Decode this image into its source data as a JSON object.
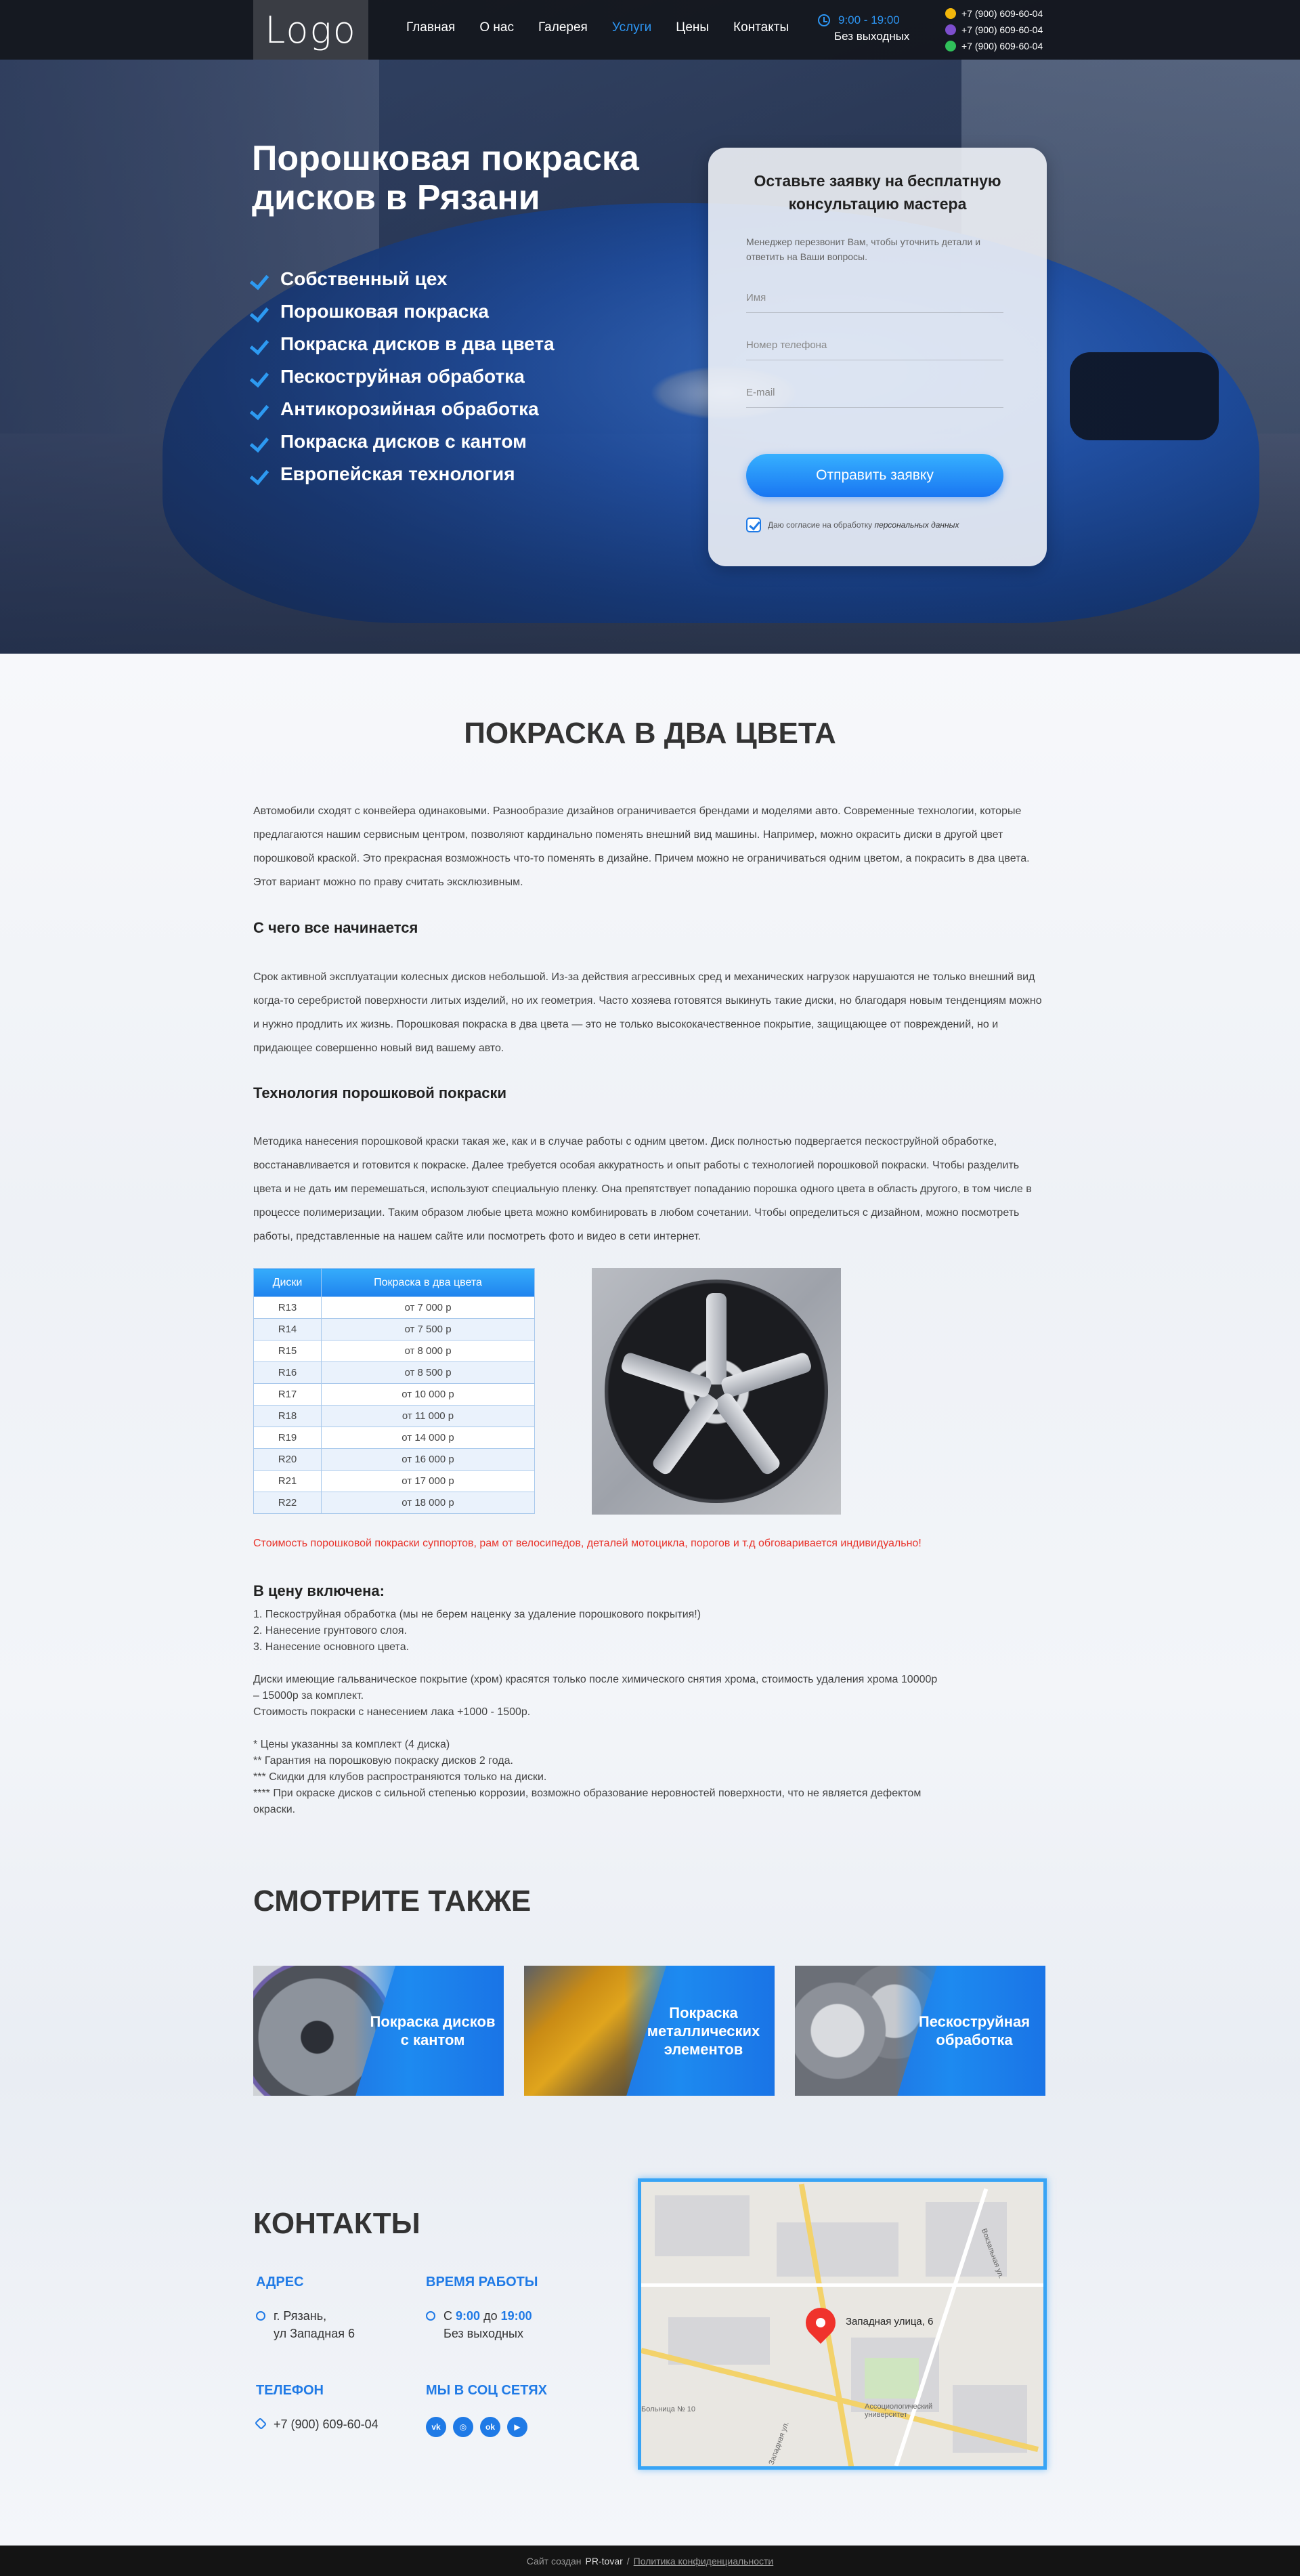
{
  "header": {
    "logo": "Logo",
    "nav": [
      "Главная",
      "О нас",
      "Галерея",
      "Услуги",
      "Цены",
      "Контакты"
    ],
    "active_nav": "Услуги",
    "hours_time": "9:00 - 19:00",
    "hours_days": "Без выходных",
    "phones": [
      "+7 (900) 609-60-04",
      "+7 (900) 609-60-04",
      "+7 (900) 609-60-04"
    ]
  },
  "hero": {
    "title": "Порошковая покраска дисков в Рязани",
    "features": [
      "Собственный цех",
      "Порошковая покраска",
      "Покраска дисков в два цвета",
      "Пескоструйная обработка",
      "Антикорозийная обработка",
      "Покраска дисков с кантом",
      "Европейская технология"
    ]
  },
  "form": {
    "title": "Оставьте заявку на бесплатную консультацию мастера",
    "note": "Менеджер перезвонит Вам, чтобы уточнить детали и ответить на Ваши вопросы.",
    "name_placeholder": "Имя",
    "phone_placeholder": "Номер телефона",
    "email_placeholder": "E-mail",
    "submit": "Отправить заявку",
    "consent_prefix": "Даю согласие на обработку",
    "consent_link": "персональных данных"
  },
  "article": {
    "title": "ПОКРАСКА В ДВА ЦВЕТА",
    "intro": "Автомобили сходят с конвейера одинаковыми. Разнообразие дизайнов ограничивается брендами и моделями авто. Современные технологии, которые предлагаются нашим сервисным центром, позволяют кардинально поменять внешний вид машины. Например, можно окрасить диски в другой цвет порошковой краской. Это прекрасная возможность что-то поменять в дизайне. Причем можно не ограничиваться одним цветом, а покрасить в два цвета. Этот вариант можно по праву считать эксклюзивным.",
    "sub1": "С чего все начинается",
    "para1": "Срок активной эксплуатации колесных дисков небольшой. Из-за действия агрессивных сред и механических нагрузок нарушаются не только внешний вид когда-то серебристой поверхности литых изделий, но их геометрия. Часто хозяева готовятся выкинуть такие диски, но благодаря новым тенденциям можно и нужно продлить их жизнь. Порошковая покраска в два цвета — это не только высококачественное покрытие, защищающее от повреждений, но и придающее совершенно новый вид вашему авто.",
    "sub2": "Технология порошковой покраски",
    "para2": "Методика нанесения порошковой краски такая же, как и в случае работы с одним цветом. Диск полностью подвергается пескоструйной обработке, восстанавливается и готовится к покраске. Далее требуется особая аккуратность и опыт работы с технологией порошковой покраски. Чтобы разделить цвета и не дать им перемешаться, используют специальную пленку. Она препятствует попаданию порошка одного цвета в область другого, в том числе в процессе полимеризации. Таким образом любые цвета можно комбинировать в любом сочетании. Чтобы определиться с дизайном, можно посмотреть работы, представленные на нашем сайте или посмотреть фото и видео в сети интернет."
  },
  "price_table": {
    "headers": [
      "Диски",
      "Покраска в два цвета"
    ],
    "rows": [
      [
        "R13",
        "от 7 000 р"
      ],
      [
        "R14",
        "от 7 500 р"
      ],
      [
        "R15",
        "от 8 000 р"
      ],
      [
        "R16",
        "от 8 500 р"
      ],
      [
        "R17",
        "от 10 000 р"
      ],
      [
        "R18",
        "от 11 000 р"
      ],
      [
        "R19",
        "от 14 000 р"
      ],
      [
        "R20",
        "от 16 000 р"
      ],
      [
        "R21",
        "от 17 000 р"
      ],
      [
        "R22",
        "от 18 000 р"
      ]
    ]
  },
  "red_note": "Стоимость порошковой покраски суппортов, рам от велосипедов, деталей мотоцикла, порогов и т.д обговаривается индивидуально!",
  "included": {
    "title": "В цену включена:",
    "lines": [
      "1. Пескоструйная обработка (мы не берем наценку за удаление порошкового покрытия!)",
      "2. Нанесение грунтового слоя.",
      "3. Нанесение основного цвета.",
      "",
      "Диски имеющие гальваническое покрытие (хром) красятся только после химического снятия хрома, стоимость удаления хрома 10000р – 15000р за комплект.",
      "Стоимость покраски с нанесением лака +1000 - 1500р.",
      "",
      "* Цены указанны за комплект (4 диска)",
      "** Гарантия на порошковую покраску дисков 2 года.",
      "*** Скидки для клубов распространяются только на диски.",
      "**** При окраске дисков с сильной степенью коррозии,  возможно образование неровностей поверхности, что не является дефектом окраски."
    ]
  },
  "see_also": {
    "title": "СМОТРИТЕ ТАКЖЕ",
    "cards": [
      "Покраска дисков с кантом",
      "Покраска металлических элементов",
      "Пескоструйная обработка"
    ]
  },
  "contacts": {
    "title": "КОНТАКТЫ",
    "address_head": "АДРЕС",
    "address_line1": "г. Рязань,",
    "address_line2": "ул Западная 6",
    "hours_head": "ВРЕМЯ РАБОТЫ",
    "hours_prefix": "С",
    "hours_from": "9:00",
    "hours_mid": "до",
    "hours_to": "19:00",
    "hours_days": "Без выходных",
    "phone_head": "ТЕЛЕФОН",
    "phone": "+7 (900) 609-60-04",
    "social_head": "МЫ В СОЦ СЕТЯХ",
    "socials": [
      "vk",
      "ig",
      "ok",
      "yt"
    ]
  },
  "map": {
    "label": "Западная улица, 6",
    "uni": "Ассоциологический университет",
    "hospital": "Больница № 10",
    "street1": "Вокзальная ул.",
    "street2": "Западная ул."
  },
  "footer": {
    "made_by_prefix": "Сайт создан",
    "made_by": "PR-tovar",
    "sep": "/",
    "policy": "Политика конфиденциальности"
  },
  "colors": {
    "accent": "#1f7ae6",
    "accent_light": "#2d95f2",
    "note_red": "#e8342c",
    "header_bg": "#14161c"
  }
}
